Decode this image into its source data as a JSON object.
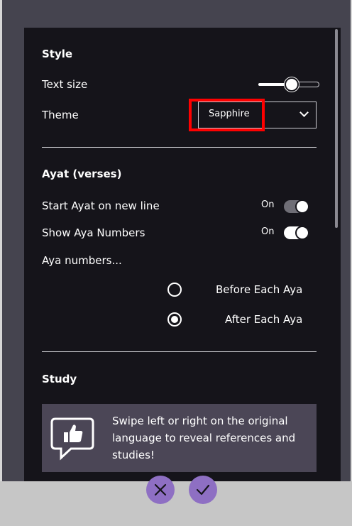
{
  "style": {
    "heading": "Style",
    "text_size_label": "Text size",
    "text_size_level": 0.6,
    "theme_label": "Theme",
    "theme_value": "Sapphire"
  },
  "ayat": {
    "heading": "Ayat (verses)",
    "start_new_line_label": "Start Ayat on new line",
    "start_new_line_state": "On",
    "show_numbers_label": "Show Aya Numbers",
    "show_numbers_state": "On",
    "aya_numbers_label": "Aya numbers...",
    "options": [
      "Before Each Aya",
      "After Each Aya"
    ],
    "selected_option": "After Each Aya"
  },
  "study": {
    "heading": "Study",
    "tip_text": "Swipe left or right on the original language to reveal references and studies!",
    "tip_icon": "thumbs-up-chat-icon"
  },
  "actions": {
    "cancel_icon": "close-icon",
    "confirm_icon": "check-icon"
  },
  "colors": {
    "accent": "#8e6fc3",
    "panel": "#15141a",
    "highlight": "#ff0000"
  }
}
